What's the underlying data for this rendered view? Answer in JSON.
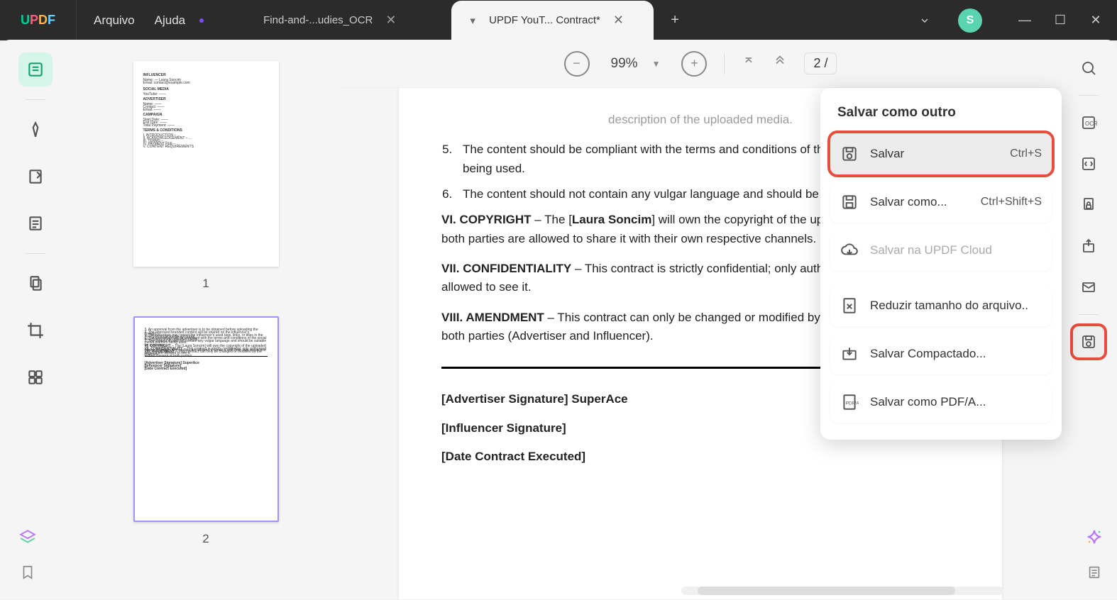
{
  "menu": {
    "arquivo": "Arquivo",
    "ajuda": "Ajuda"
  },
  "tabs": {
    "tab1": "Find-and-...udies_OCR",
    "tab2": "UPDF YouT... Contract*"
  },
  "avatar_initial": "S",
  "zoom": "99%",
  "page_indicator": "2 /",
  "thumbnails": {
    "page1": "1",
    "page2": "2"
  },
  "document": {
    "li5": "The content should be compliant with the terms and conditions of the social media platform being used.",
    "li6": "The content should not contain any vulgar language and should be suitable for everyone.",
    "h6": "VI. COPYRIGHT",
    "p6a": " – The [",
    "p6_name": "Laura Soncim",
    "p6b": "] will own the copyright of the uploaded media. However, both parties are allowed to share it with their own respective channels.",
    "h7": "VII. CONFIDENTIALITY",
    "p7": " – This contract is strictly confidential; only authorized persons are allowed to see it.",
    "h8": "VIII. AMENDMENT",
    "p8": " – This contract can only be changed or modified by the written consent of both parties (Advertiser and Influencer).",
    "sig1": "[Advertiser Signature] SuperAce",
    "sig2": "[Influencer Signature]",
    "sig3": "[Date Contract Executed]"
  },
  "popup": {
    "title": "Salvar como outro",
    "item1_label": "Salvar",
    "item1_shortcut": "Ctrl+S",
    "item2_label": "Salvar como...",
    "item2_shortcut": "Ctrl+Shift+S",
    "item3_label": "Salvar na UPDF Cloud",
    "item4_label": "Reduzir tamanho do arquivo..",
    "item5_label": "Salvar Compactado...",
    "item6_label": "Salvar como PDF/A..."
  }
}
